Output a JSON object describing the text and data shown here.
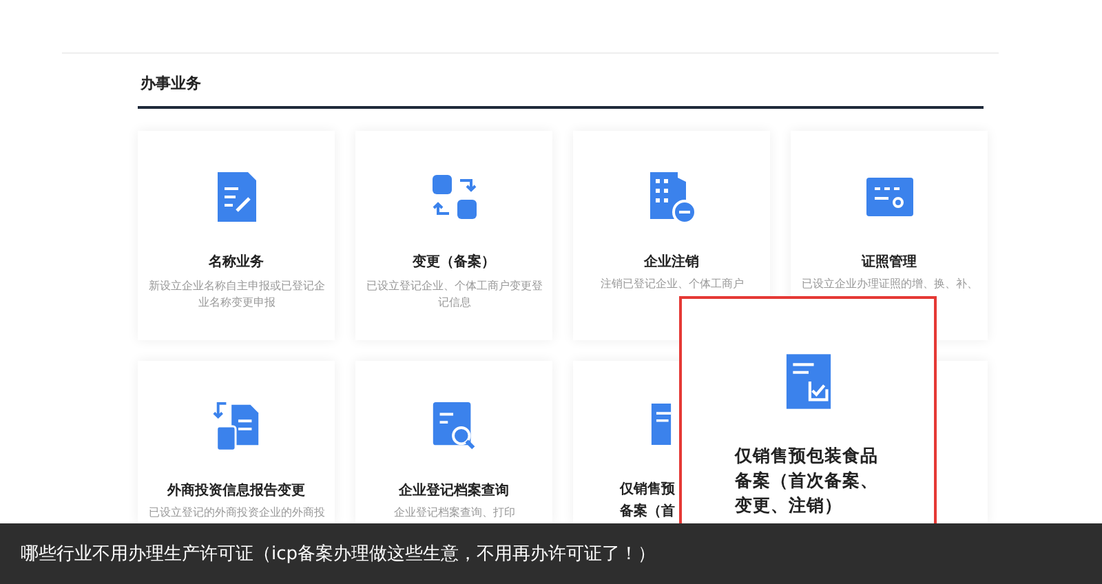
{
  "section": {
    "title": "办事业务"
  },
  "cards": [
    {
      "kind": "full",
      "title": "名称业务",
      "description": "新设立企业名称自主申报或已登记企业名称变更申报"
    },
    {
      "kind": "full",
      "title": "变更（备案）",
      "description": "已设立登记企业、个体工商户变更登记信息"
    },
    {
      "kind": "full",
      "title": "企业注销",
      "description": "注销已登记企业、个体工商户"
    },
    {
      "kind": "full",
      "title": "证照管理",
      "description": "已设立企业办理证照的增、换、补、"
    },
    {
      "kind": "full",
      "title": "外商投资信息报告变更",
      "description": "已设立登记的外商投资企业的外商投"
    },
    {
      "kind": "full",
      "title": "企业登记档案查询",
      "description": "企业登记档案查询、打印"
    },
    {
      "kind": "covered",
      "title_lines": [
        "仅销售预",
        "备案（首"
      ]
    },
    {
      "kind": "blank"
    }
  ],
  "popup": {
    "title": "仅销售预包装食品备案（首次备案、变更、注销）"
  },
  "caption": "哪些行业不用办理生产许可证（icp备案办理做这些生意，不用再办许可证了！）"
}
